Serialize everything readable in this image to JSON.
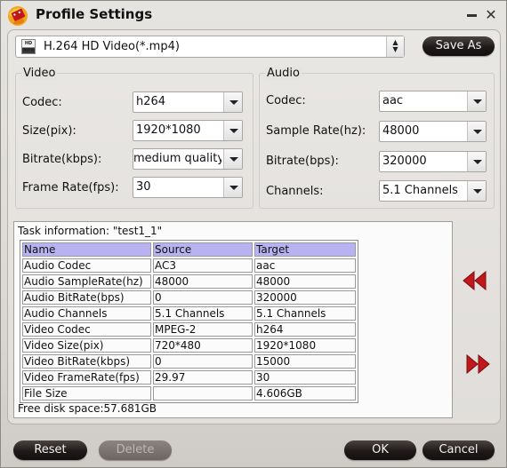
{
  "window": {
    "title": "Profile Settings",
    "minimize_icon": "minimize-icon",
    "close_icon": "close-icon",
    "close_glyph": "✕"
  },
  "profile": {
    "selected": "H.264 HD Video(*.mp4)",
    "icon": "mp4-hd-icon",
    "spinner_glyph": "▲▼"
  },
  "buttons": {
    "save_as": "Save As",
    "reset": "Reset",
    "delete": "Delete",
    "ok": "OK",
    "cancel": "Cancel"
  },
  "video": {
    "title": "Video",
    "fields": [
      {
        "label": "Codec:",
        "value": "h264"
      },
      {
        "label": "Size(pix):",
        "value": "1920*1080"
      },
      {
        "label": "Bitrate(kbps):",
        "value": "medium quality"
      },
      {
        "label": "Frame Rate(fps):",
        "value": "30"
      }
    ]
  },
  "audio": {
    "title": "Audio",
    "fields": [
      {
        "label": "Codec:",
        "value": "aac"
      },
      {
        "label": "Sample Rate(hz):",
        "value": "48000"
      },
      {
        "label": "Bitrate(bps):",
        "value": "320000"
      },
      {
        "label": "Channels:",
        "value": "5.1 Channels"
      }
    ]
  },
  "task": {
    "title": "Task information: \"test1_1\"",
    "columns": [
      "Name",
      "Source",
      "Target"
    ],
    "rows": [
      [
        "Audio Codec",
        "AC3",
        "aac"
      ],
      [
        "Audio SampleRate(hz)",
        "48000",
        "48000"
      ],
      [
        "Audio BitRate(bps)",
        "0",
        "320000"
      ],
      [
        "Audio Channels",
        "5.1 Channels",
        "5.1 Channels"
      ],
      [
        "Video Codec",
        "MPEG-2",
        "h264"
      ],
      [
        "Video Size(pix)",
        "720*480",
        "1920*1080"
      ],
      [
        "Video BitRate(kbps)",
        "0",
        "15000"
      ],
      [
        "Video FrameRate(fps)",
        "29.97",
        "30"
      ],
      [
        "File Size",
        "",
        "4.606GB"
      ]
    ],
    "free_disk_space": "Free disk space:57.681GB"
  },
  "navigation": {
    "previous_icon": "rewind-icon",
    "next_icon": "fast-forward-icon"
  },
  "colors": {
    "header_row": "#b8b3f0",
    "nav_arrow": "#c0181b",
    "button_dark": "#1f1a19"
  }
}
